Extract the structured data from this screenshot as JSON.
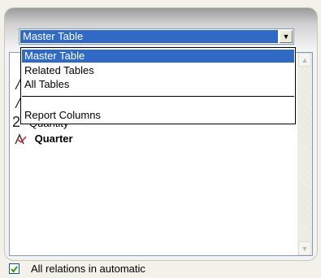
{
  "table_selector": {
    "selected_value": "Master Table",
    "options": [
      {
        "label": "Master Table",
        "selected": true
      },
      {
        "label": "Related Tables",
        "selected": false
      },
      {
        "label": "All Tables",
        "selected": false
      },
      {
        "label": "Report Columns",
        "selected": false
      }
    ]
  },
  "field_list": {
    "visible_item": {
      "label": "Quarter",
      "icon": "measure-axis-icon"
    },
    "hidden_item_partial_text": "Quantity"
  },
  "auto_relations": {
    "label": "All relations in automatic",
    "checked": true
  },
  "colors": {
    "selection": "#316ac5",
    "border": "#7f9db9",
    "icon_red": "#cc2222"
  }
}
